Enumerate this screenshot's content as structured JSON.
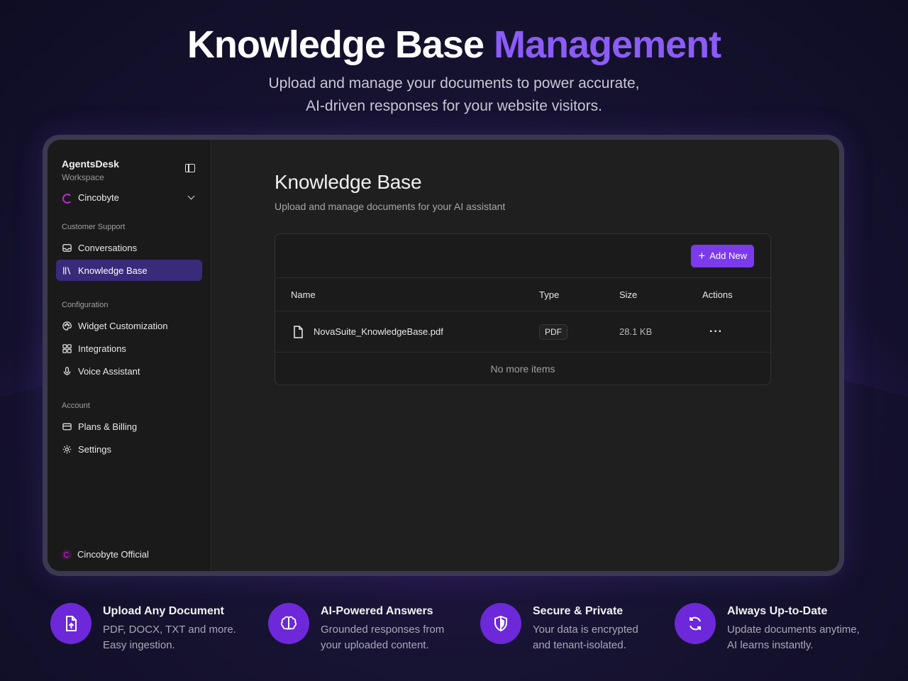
{
  "hero": {
    "title_main": "Knowledge Base",
    "title_accent": "Management",
    "subtitle_line1": "Upload and manage your documents to power accurate,",
    "subtitle_line2": "AI-driven responses for your website visitors."
  },
  "sidebar": {
    "app_name": "AgentsDesk",
    "workspace_label": "Workspace",
    "org_name": "Cincobyte",
    "sections": [
      {
        "label": "Customer Support",
        "items": [
          {
            "label": "Conversations",
            "icon": "inbox-icon",
            "active": false
          },
          {
            "label": "Knowledge Base",
            "icon": "library-icon",
            "active": true
          }
        ]
      },
      {
        "label": "Configuration",
        "items": [
          {
            "label": "Widget Customization",
            "icon": "palette-icon",
            "active": false
          },
          {
            "label": "Integrations",
            "icon": "grid-icon",
            "active": false
          },
          {
            "label": "Voice Assistant",
            "icon": "mic-icon",
            "active": false
          }
        ]
      },
      {
        "label": "Account",
        "items": [
          {
            "label": "Plans & Billing",
            "icon": "credit-card-icon",
            "active": false
          },
          {
            "label": "Settings",
            "icon": "gear-icon",
            "active": false
          }
        ]
      }
    ],
    "footer_account": "Cincobyte Official"
  },
  "main": {
    "title": "Knowledge Base",
    "description": "Upload and manage documents for your AI assistant",
    "add_button_label": "Add New",
    "table": {
      "headers": [
        "Name",
        "Type",
        "Size",
        "Actions"
      ],
      "rows": [
        {
          "name": "NovaSuite_KnowledgeBase.pdf",
          "type": "PDF",
          "size": "28.1 KB",
          "actions": "···"
        }
      ],
      "empty_text": "No more items"
    }
  },
  "features": [
    {
      "title": "Upload Any Document",
      "line1": "PDF, DOCX, TXT and more.",
      "line2": "Easy ingestion.",
      "icon": "file-upload-icon"
    },
    {
      "title": "AI-Powered Answers",
      "line1": "Grounded responses from",
      "line2": "your uploaded content.",
      "icon": "brain-icon"
    },
    {
      "title": "Secure & Private",
      "line1": "Your data is encrypted",
      "line2": "and tenant-isolated.",
      "icon": "shield-icon"
    },
    {
      "title": "Always Up-to-Date",
      "line1": "Update documents anytime,",
      "line2": "AI learns instantly.",
      "icon": "refresh-icon"
    }
  ],
  "colors": {
    "accent": "#8b5cf6",
    "button": "#7c3aed",
    "active_nav": "#3a2a7a",
    "feature_icon_bg": "#6d28d9"
  }
}
